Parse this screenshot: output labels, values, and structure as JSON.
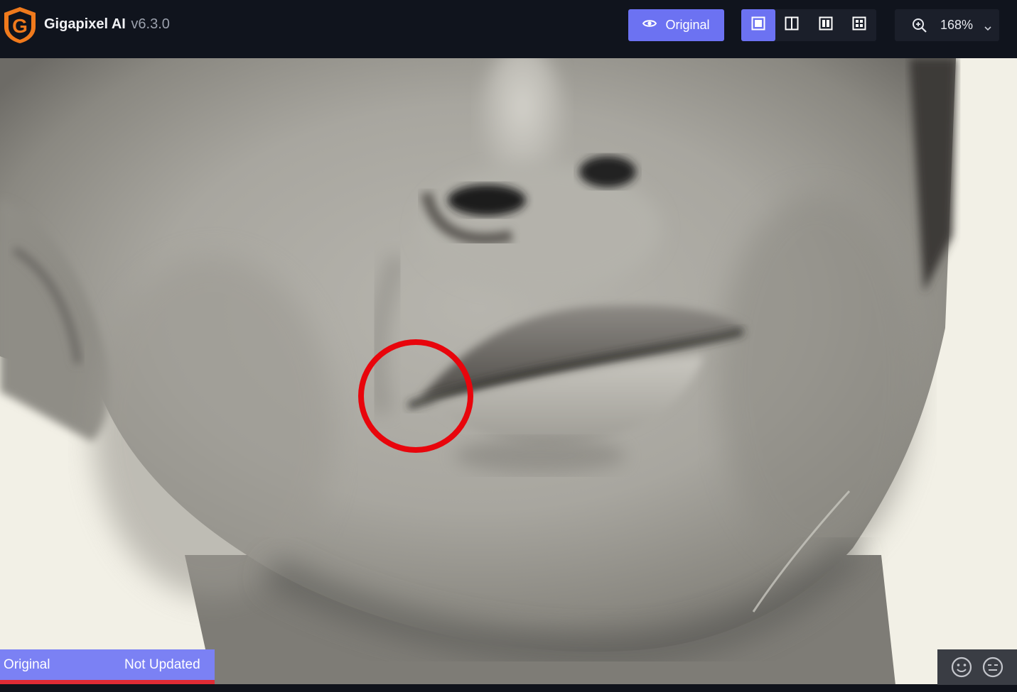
{
  "header": {
    "app_name": "Gigapixel AI",
    "version": "v6.3.0",
    "logo_letter": "G",
    "original_button_label": "Original",
    "original_button_icon": "eye-icon",
    "view_modes": [
      {
        "name": "single-view",
        "icon": "single-view-icon",
        "active": true
      },
      {
        "name": "split-view",
        "icon": "split-view-icon",
        "active": false
      },
      {
        "name": "side-by-side-view",
        "icon": "side-by-side-view-icon",
        "active": false
      },
      {
        "name": "grid-view",
        "icon": "grid-view-icon",
        "active": false
      }
    ],
    "zoom": {
      "value": "168%",
      "icon": "zoom-in-icon"
    }
  },
  "status": {
    "left_label": "Original",
    "right_label": "Not Updated"
  },
  "feedback": {
    "icons": [
      "smile-icon",
      "neutral-face-icon"
    ]
  },
  "colors": {
    "accent": "#6c72f2",
    "header_bg": "#10141d",
    "status_bg": "#7b81f4",
    "status_underline": "#e02b35",
    "marker": "#e8050c",
    "logo": "#f07a1c"
  }
}
